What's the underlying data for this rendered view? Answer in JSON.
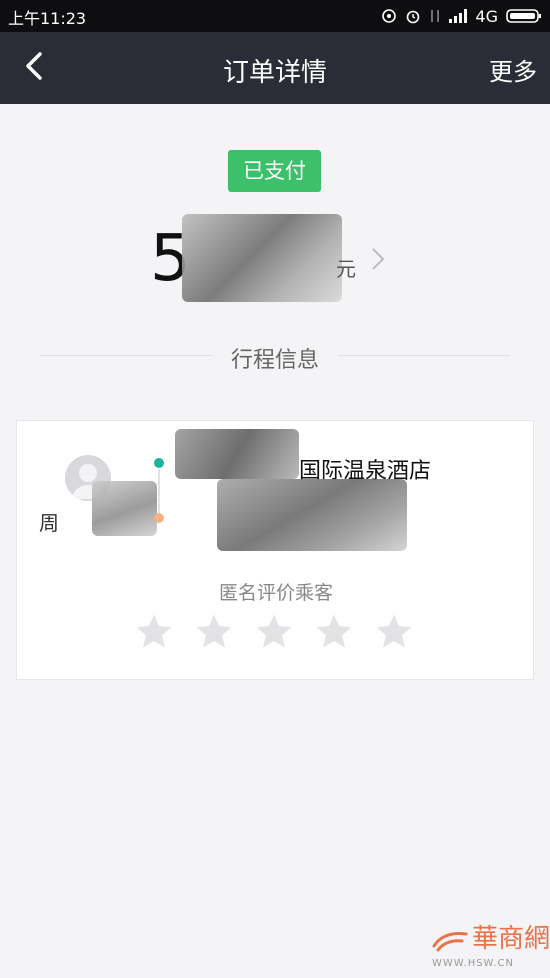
{
  "status_bar": {
    "time": "上午11:23",
    "network": "4G",
    "icons": [
      "notification-icon",
      "alarm-icon",
      "data-transfer-icon",
      "signal-icon",
      "battery-icon"
    ]
  },
  "nav": {
    "title": "订单详情",
    "more_label": "更多",
    "back_icon": "chevron-left-icon"
  },
  "order": {
    "status_badge": "已支付",
    "amount_prefix": "5",
    "amount_unit": "元"
  },
  "section": {
    "title": "行程信息"
  },
  "trip": {
    "destination": "国际温泉酒店",
    "passenger_initial": "周"
  },
  "rating": {
    "label": "匿名评价乘客",
    "stars_total": 5,
    "stars_filled": 0
  },
  "watermark": {
    "brand": "華商網",
    "url": "WWW.HSW.CN"
  },
  "colors": {
    "nav_bg": "#2b2d36",
    "badge_green": "#3cc06a",
    "route_start": "#1fb39a",
    "route_end": "#f6b18a",
    "star_empty": "#e3e3e6"
  }
}
